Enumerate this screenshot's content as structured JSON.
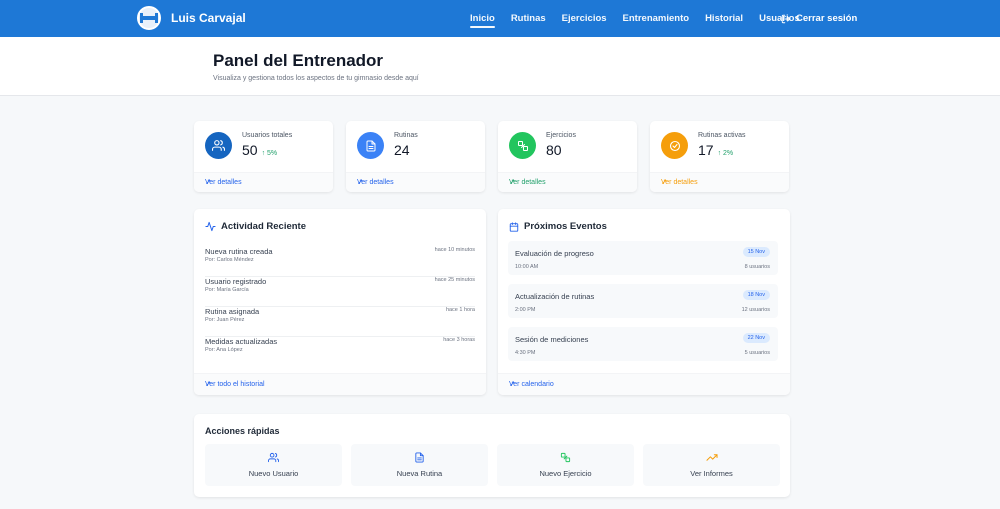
{
  "nav": {
    "brand": "Luis Carvajal",
    "links": [
      {
        "label": "Inicio"
      },
      {
        "label": "Rutinas"
      },
      {
        "label": "Ejercicios"
      },
      {
        "label": "Entrenamiento"
      },
      {
        "label": "Historial"
      },
      {
        "label": "Usuarios"
      }
    ],
    "logout": "Cerrar sesión",
    "color": "#1e78d6"
  },
  "header": {
    "title": "Panel del Entrenador",
    "subtitle": "Visualiza y gestiona todos los aspectos de tu gimnasio desde aquí"
  },
  "stats": [
    {
      "label": "Usuarios totales",
      "value": "50",
      "trend": "↑ 5%",
      "footer": "Ver detalles",
      "icon": "users-icon",
      "color": "#1565c0"
    },
    {
      "label": "Rutinas",
      "value": "24",
      "trend": "",
      "footer": "Ver detalles",
      "icon": "document-icon",
      "color": "#3b82f6"
    },
    {
      "label": "Ejercicios",
      "value": "80",
      "trend": "",
      "footer": "Ver detalles",
      "icon": "exercise-icon",
      "color": "#22c55e"
    },
    {
      "label": "Rutinas activas",
      "value": "17",
      "trend": "↑ 2%",
      "footer": "Ver detalles",
      "icon": "check-circle-icon",
      "color": "#f59e0b"
    }
  ],
  "activity": {
    "title": "Actividad Reciente",
    "items": [
      {
        "title": "Nueva rutina creada",
        "by": "Por: Carlos Méndez",
        "time": "hace 10 minutos"
      },
      {
        "title": "Usuario registrado",
        "by": "Por: María García",
        "time": "hace 25 minutos"
      },
      {
        "title": "Rutina asignada",
        "by": "Por: Juan Pérez",
        "time": "hace 1 hora"
      },
      {
        "title": "Medidas actualizadas",
        "by": "Por: Ana López",
        "time": "hace 3 horas"
      }
    ],
    "footer": "Ver todo el historial"
  },
  "events": {
    "title": "Próximos Eventos",
    "items": [
      {
        "title": "Evaluación de progreso",
        "time": "10:00 AM",
        "date": "15 Nov",
        "users": "8 usuarios"
      },
      {
        "title": "Actualización de rutinas",
        "time": "2:00 PM",
        "date": "18 Nov",
        "users": "12 usuarios"
      },
      {
        "title": "Sesión de mediciones",
        "time": "4:30 PM",
        "date": "22 Nov",
        "users": "5 usuarios"
      }
    ],
    "footer": "Ver calendario"
  },
  "quick": {
    "title": "Acciones rápidas",
    "items": [
      {
        "label": "Nuevo Usuario",
        "icon": "users-icon",
        "color": "#2563eb"
      },
      {
        "label": "Nueva Rutina",
        "icon": "document-icon",
        "color": "#2563eb"
      },
      {
        "label": "Nuevo Ejercicio",
        "icon": "exercise-icon",
        "color": "#22c55e"
      },
      {
        "label": "Ver Informes",
        "icon": "trending-up-icon",
        "color": "#f59e0b"
      }
    ]
  }
}
